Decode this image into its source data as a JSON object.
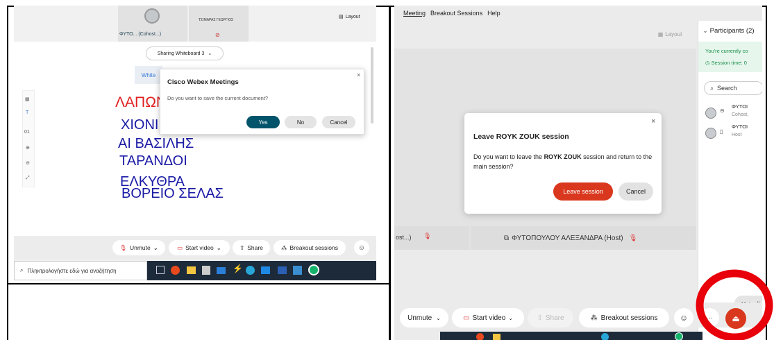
{
  "left": {
    "video_strip": {
      "participant1": {
        "name": "ΦΥΤΟ... (Cohost...)"
      },
      "participant2": {
        "name": "ΤΣΙΜΑΡΑΣ ΓΕΩΡΓΙΟΣ"
      },
      "layout_label": "Layout"
    },
    "share_dropdown_label": "Sharing Whiteboard 3",
    "white_tab_label": "White",
    "whiteboard_words": [
      "ΛΑΠΩΝ",
      "ΧΙΟΝΙ",
      "ΑΙ ΒΑΣΙΛΗΣ",
      "ΤΑΡΑΝΔΟΙ",
      "ΕΛΚΥΘΡΑ",
      "ΒΟΡΕΙΟ ΣΕΛΑΣ"
    ],
    "dialog": {
      "title": "Cisco Webex Meetings",
      "message": "Do you want to save the current document?",
      "yes": "Yes",
      "no": "No",
      "cancel": "Cancel"
    },
    "controls": {
      "unmute": "Unmute",
      "start_video": "Start video",
      "share": "Share",
      "breakout": "Breakout sessions"
    },
    "taskbar": {
      "search_placeholder": "Πληκτρολογήστε εδώ για αναζήτηση"
    }
  },
  "right": {
    "menu": [
      "Meeting",
      "Breakout Sessions",
      "Help"
    ],
    "layout_label": "Layout",
    "participants_panel": {
      "title": "Participants (2)",
      "notice": "You're currently co",
      "session_time": "Session time: 0",
      "search_placeholder": "Search",
      "list": [
        {
          "name": "ΦΥΤΟΙ",
          "role": "Cohost,"
        },
        {
          "name": "ΦΥΤΟΙ",
          "role": "Host"
        }
      ],
      "mute_all": "Mute all"
    },
    "dialog": {
      "title": "Leave ROYK ZOUK session",
      "msg_part1": "Do you want to leave the ",
      "msg_bold": "ROYK ZOUK",
      "msg_part2": " session and return to the main session?",
      "leave": "Leave session",
      "cancel": "Cancel"
    },
    "tile_left_label": "ost...)",
    "tile_host_label": "ΦΥΤΟΠΟΥΛΟΥ ΑΛΕΞΑΝΔΡΑ (Host)",
    "controls": {
      "unmute": "Unmute",
      "start_video": "Start video",
      "share": "Share",
      "breakout": "Breakout sessions",
      "more": "···"
    }
  },
  "colors": {
    "accent_teal": "#02546b",
    "leave_red": "#d9381e",
    "annotation_red": "#e8000a",
    "word_red": "#e02020",
    "word_blue": "#1a1aa6"
  }
}
